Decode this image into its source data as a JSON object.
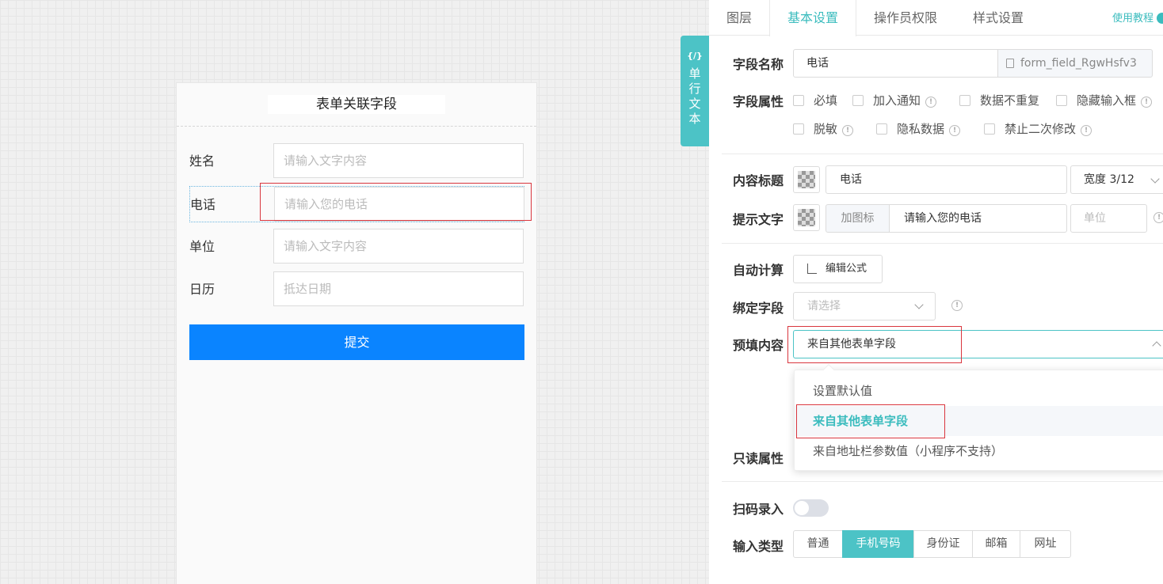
{
  "form": {
    "title": "表单关联字段",
    "fields": [
      {
        "label": "姓名",
        "placeholder": "请输入文字内容"
      },
      {
        "label": "电话",
        "placeholder": "请输入您的电话"
      },
      {
        "label": "单位",
        "placeholder": "请输入文字内容"
      },
      {
        "label": "日历",
        "placeholder": "抵达日期"
      }
    ],
    "submit_label": "提交"
  },
  "side_tab": {
    "code": "{/}",
    "label": "单行文本"
  },
  "tabs": [
    {
      "label": "图层"
    },
    {
      "label": "基本设置",
      "active": true
    },
    {
      "label": "操作员权限"
    },
    {
      "label": "样式设置"
    }
  ],
  "tutorial_label": "使用教程",
  "settings": {
    "field_name_label": "字段名称",
    "field_name_value": "电话",
    "field_id": "form_field_RgwHsfv3",
    "field_props_label": "字段属性",
    "props": {
      "required": "必填",
      "notify": "加入通知",
      "unique": "数据不重复",
      "hide_input": "隐藏输入框",
      "desensitize": "脱敏",
      "private": "隐私数据",
      "no_edit": "禁止二次修改"
    },
    "content_title_label": "内容标题",
    "content_title_value": "电话",
    "width_value": "宽度 3/12",
    "hint_label": "提示文字",
    "add_icon_label": "加图标",
    "hint_value": "请输入您的电话",
    "unit_placeholder": "单位",
    "auto_calc_label": "自动计算",
    "edit_formula_label": "编辑公式",
    "bind_field_label": "绑定字段",
    "bind_field_placeholder": "请选择",
    "prefill_label": "预填内容",
    "prefill_value": "来自其他表单字段",
    "prefill_options": [
      "设置默认值",
      "来自其他表单字段",
      "来自地址栏参数值（小程序不支持）"
    ],
    "readonly_label": "只读属性",
    "scan_label": "扫码录入",
    "input_type_label": "输入类型",
    "input_types": [
      "普通",
      "手机号码",
      "身份证",
      "邮箱",
      "网址"
    ]
  },
  "colors": {
    "accent": "#4cc3c6",
    "primary": "#0a84ff",
    "highlight": "#d9363e"
  }
}
